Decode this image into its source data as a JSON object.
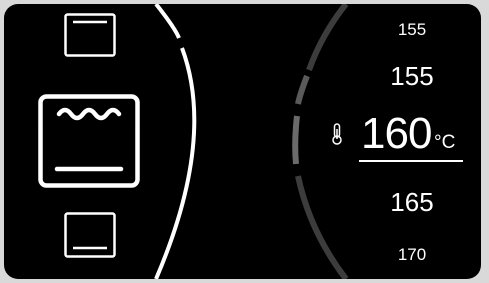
{
  "oven_modes": [
    {
      "icon": "oven-top-heat-icon",
      "selected": false
    },
    {
      "icon": "oven-convection-icon",
      "selected": true
    },
    {
      "icon": "oven-bottom-heat-icon",
      "selected": false
    }
  ],
  "temperature_picker": {
    "values_above": [
      "155",
      "155"
    ],
    "selected_value": "160",
    "unit": "°C",
    "values_below": [
      "165",
      "170"
    ],
    "icon": "thermometer-icon"
  },
  "colors": {
    "background": "#000000",
    "foreground": "#ffffff",
    "arc_dim": "#4a4a4a"
  }
}
